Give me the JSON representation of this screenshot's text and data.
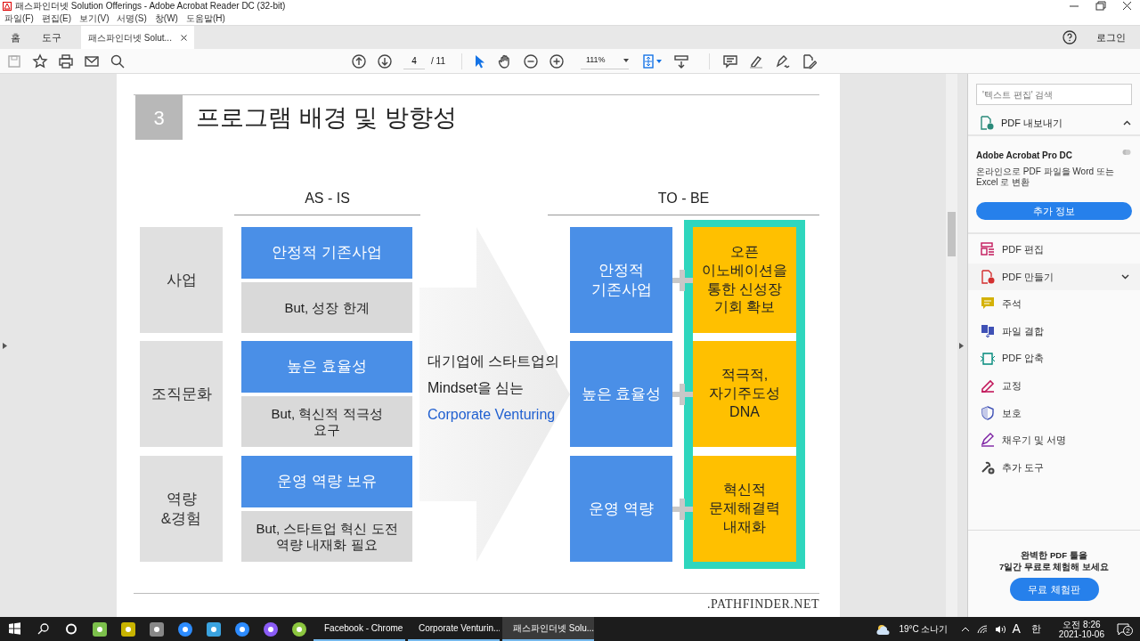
{
  "window": {
    "title": "패스파인더넷 Solution Offerings - Adobe Acrobat Reader DC (32-bit)"
  },
  "menu": [
    "파일(F)",
    "편집(E)",
    "보기(V)",
    "서명(S)",
    "창(W)",
    "도움말(H)"
  ],
  "tabs": [
    {
      "label": "홈",
      "selected": false
    },
    {
      "label": "도구",
      "selected": false
    },
    {
      "label": "패스파인더넷 Solut...",
      "selected": true,
      "closable": true
    }
  ],
  "account": {
    "login": "로그인"
  },
  "toolbar": {
    "page_current": "4",
    "page_total": "/ 11",
    "zoom": "111%"
  },
  "slide": {
    "number": "3",
    "title": "프로그램 배경 및 방향성",
    "as_is_heading": "AS - IS",
    "to_be_heading": "TO - BE",
    "rows": [
      {
        "label": "사업",
        "as_is": "안정적 기존사업",
        "limit": "But, 성장 한계",
        "to_be": "안정적\n기존사업",
        "goal": "오픈\n이노베이션을\n통한 신성장\n기회 확보"
      },
      {
        "label": "조직문화",
        "as_is": "높은 효율성",
        "limit": "But, 혁신적 적극성\n요구",
        "to_be": "높은 효율성",
        "goal": "적극적,\n자기주도성\nDNA"
      },
      {
        "label": "역량\n&경험",
        "as_is": "운영 역량 보유",
        "limit": "But, 스타트업 혁신 도전\n역량 내재화 필요",
        "to_be": "운영 역량",
        "goal": "혁신적\n문제해결력\n내재화"
      }
    ],
    "center_text": [
      {
        "text": "대기업에 스타트업의",
        "highlight": false
      },
      {
        "text": "Mindset을 심는",
        "highlight": false
      },
      {
        "text": "Corporate Venturing",
        "highlight": true
      }
    ],
    "logo": ".PATHFINDER.NET"
  },
  "right_panel": {
    "search": {
      "placeholder": "'텍스트 편집' 검색"
    },
    "export": {
      "label": "PDF 내보내기",
      "expanded": true
    },
    "promo": {
      "title": "Adobe Acrobat Pro DC",
      "description": "온라인으로 PDF 파일을 Word 또는 Excel 로 변환",
      "button": "추가 정보"
    },
    "tools": [
      {
        "label": "PDF 편집",
        "expandable": false
      },
      {
        "label": "PDF 만들기",
        "expandable": true
      },
      {
        "label": "주석",
        "expandable": false
      },
      {
        "label": "파일 결합",
        "expandable": false
      },
      {
        "label": "PDF 압축",
        "expandable": false
      },
      {
        "label": "교정",
        "expandable": false
      },
      {
        "label": "보호",
        "expandable": false
      },
      {
        "label": "채우기 및 서명",
        "expandable": false
      },
      {
        "label": "추가 도구",
        "expandable": false
      }
    ],
    "trial": {
      "text": "완벽한 PDF 툴을\n7일간 무료로 체험해 보세요",
      "button": "무료 체험판"
    }
  },
  "taskbar": {
    "apps": [
      {
        "label": "Facebook - Chrome",
        "selected": false
      },
      {
        "label": "Corporate Venturin...",
        "selected": false
      },
      {
        "label": "패스파인더넷 Solu...",
        "selected": true
      }
    ],
    "weather": "19°C 소나기",
    "input_mode": "A",
    "ime": "한",
    "time": "오전 8:26",
    "date": "2021-10-06",
    "notifications": "2"
  }
}
